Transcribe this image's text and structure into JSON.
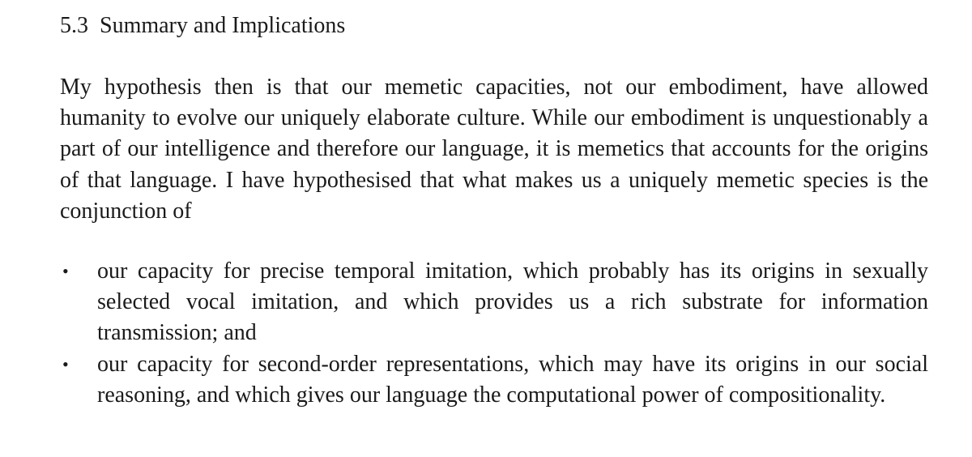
{
  "section": {
    "number": "5.3",
    "title": "Summary and Implications"
  },
  "paragraph": {
    "text": "My hypothesis then is that our memetic capacities, not our embodiment, have allowed humanity to evolve our uniquely elaborate culture. While our embodiment is unquestionably a part of our intelligence and therefore our language, it is memetics that accounts for the origins of that language. I have hypothesised that what makes us a uniquely memetic species is the conjunction of"
  },
  "bullets": {
    "marker": "•",
    "items": [
      {
        "text": "our capacity for precise temporal imitation, which probably has its origins in sexually selected vocal imitation, and which provides us a rich substrate for information transmission; and"
      },
      {
        "text": "our capacity for second-order representations, which may have its origins in our social reasoning, and which gives our language the computational power of compositionality."
      }
    ]
  }
}
